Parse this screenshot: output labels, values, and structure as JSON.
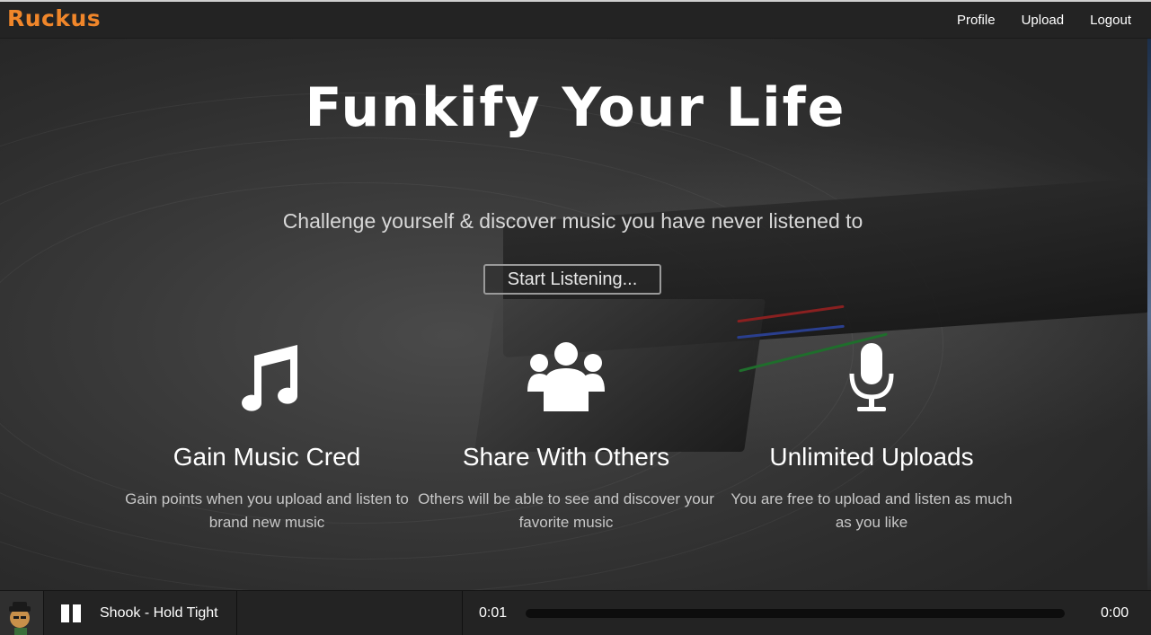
{
  "brand": "Ruckus",
  "nav": [
    {
      "label": "Profile"
    },
    {
      "label": "Upload"
    },
    {
      "label": "Logout"
    }
  ],
  "hero": {
    "title": "Funkify Your Life",
    "subtitle": "Challenge yourself & discover music you have never listened to",
    "cta": "Start Listening..."
  },
  "features": [
    {
      "icon": "music-note-icon",
      "title": "Gain Music Cred",
      "description": "Gain points when you upload and listen to brand new music"
    },
    {
      "icon": "users-group-icon",
      "title": "Share With Others",
      "description": "Others will be able to see and discover your favorite music"
    },
    {
      "icon": "microphone-icon",
      "title": "Unlimited Uploads",
      "description": "You are free to upload and listen as much as you like"
    }
  ],
  "player": {
    "track": "Shook - Hold Tight",
    "current_time": "0:01",
    "total_time": "0:00",
    "progress_percent": 0,
    "state": "playing"
  },
  "colors": {
    "accent": "#f0862a",
    "nav_bg": "#232323",
    "text": "#ffffff"
  }
}
